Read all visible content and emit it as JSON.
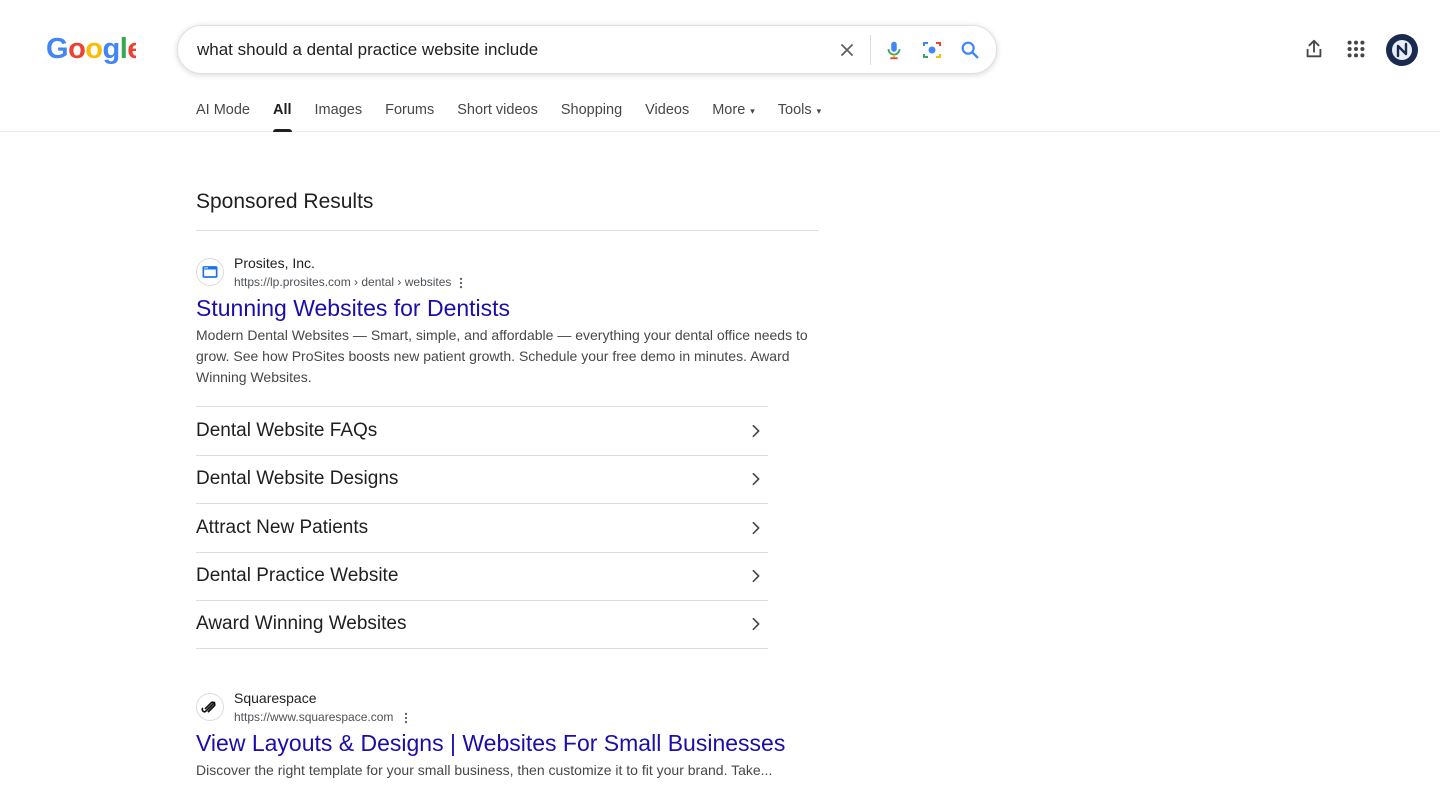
{
  "header": {
    "logo_text": "Google",
    "search": {
      "query": "what should a dental practice website include"
    },
    "icons": [
      "close-icon",
      "microphone-icon",
      "camera-icon",
      "search-icon",
      "share-icon",
      "apps-icon"
    ]
  },
  "tabs": [
    {
      "label": "AI Mode",
      "active": false
    },
    {
      "label": "All",
      "active": true
    },
    {
      "label": "Images",
      "active": false
    },
    {
      "label": "Forums",
      "active": false
    },
    {
      "label": "Short videos",
      "active": false
    },
    {
      "label": "Shopping",
      "active": false
    },
    {
      "label": "Videos",
      "active": false
    },
    {
      "label": "More",
      "active": false,
      "caret": "▾"
    },
    {
      "label": "Tools",
      "active": false,
      "caret": "▾"
    }
  ],
  "sponsored_heading": "Sponsored Results",
  "ads": [
    {
      "site_name": "Prosites, Inc.",
      "url_base": "https://lp.prosites.com",
      "url_path": " › dental › websites",
      "title": "Stunning Websites for Dentists",
      "description": "Modern Dental Websites — Smart, simple, and affordable — everything your dental office needs to grow. See how ProSites boosts new patient growth. Schedule your free demo in minutes. Award Winning Websites.",
      "sitelinks": [
        "Dental Website FAQs",
        "Dental Website Designs",
        "Attract New Patients",
        "Dental Practice Website",
        "Award Winning Websites"
      ]
    },
    {
      "site_name": "Squarespace",
      "url_base": "https://www.squarespace.com",
      "url_path": "",
      "title": "View Layouts & Designs | Websites For Small Businesses",
      "description": "Discover the right template for your small business, then customize it to fit your brand. Take..."
    }
  ],
  "colors": {
    "link_blue": "#1a0dab",
    "google_blue": "#4285F4",
    "google_red": "#EA4335",
    "google_yellow": "#FBBC05",
    "google_green": "#34A853",
    "avatar_bg": "#1a2a4f"
  }
}
